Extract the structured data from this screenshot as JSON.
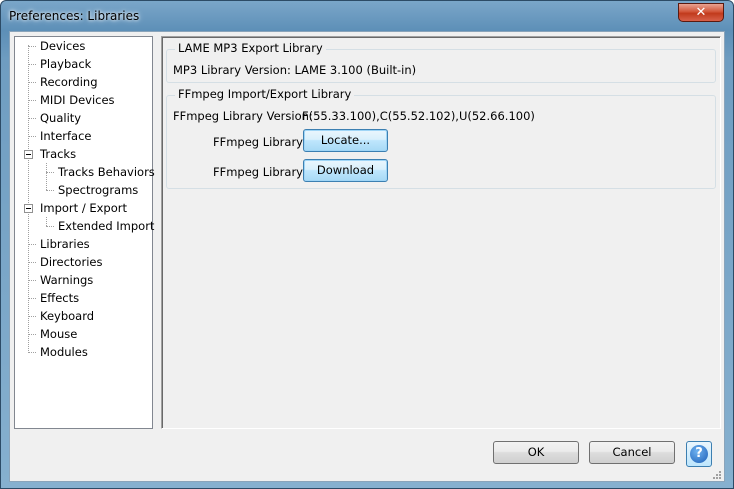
{
  "window": {
    "title": "Preferences: Libraries",
    "close_glyph": "✕"
  },
  "tree": {
    "items": [
      {
        "label": "Devices"
      },
      {
        "label": "Playback"
      },
      {
        "label": "Recording"
      },
      {
        "label": "MIDI Devices"
      },
      {
        "label": "Quality"
      },
      {
        "label": "Interface"
      },
      {
        "label": "Tracks"
      },
      {
        "label": "Tracks Behaviors"
      },
      {
        "label": "Spectrograms"
      },
      {
        "label": "Import / Export"
      },
      {
        "label": "Extended Import"
      },
      {
        "label": "Libraries"
      },
      {
        "label": "Directories"
      },
      {
        "label": "Warnings"
      },
      {
        "label": "Effects"
      },
      {
        "label": "Keyboard"
      },
      {
        "label": "Mouse"
      },
      {
        "label": "Modules"
      }
    ]
  },
  "lame": {
    "group_title": "LAME MP3 Export Library",
    "version_text": "MP3 Library Version: LAME 3.100 (Built-in)"
  },
  "ffmpeg": {
    "group_title": "FFmpeg Import/Export Library",
    "version_label": "FFmpeg Library Version:",
    "version_value": "F(55.33.100),C(55.52.102),U(52.66.100)",
    "library_label_1": "FFmpeg Library:",
    "locate_button": "Locate...",
    "library_label_2": "FFmpeg Library:",
    "download_button": "Download"
  },
  "footer": {
    "ok_button": "OK",
    "cancel_button": "Cancel",
    "help_glyph": "?"
  },
  "icons": {
    "help": "help-icon",
    "close": "close-icon",
    "expander": "collapse-icon"
  }
}
